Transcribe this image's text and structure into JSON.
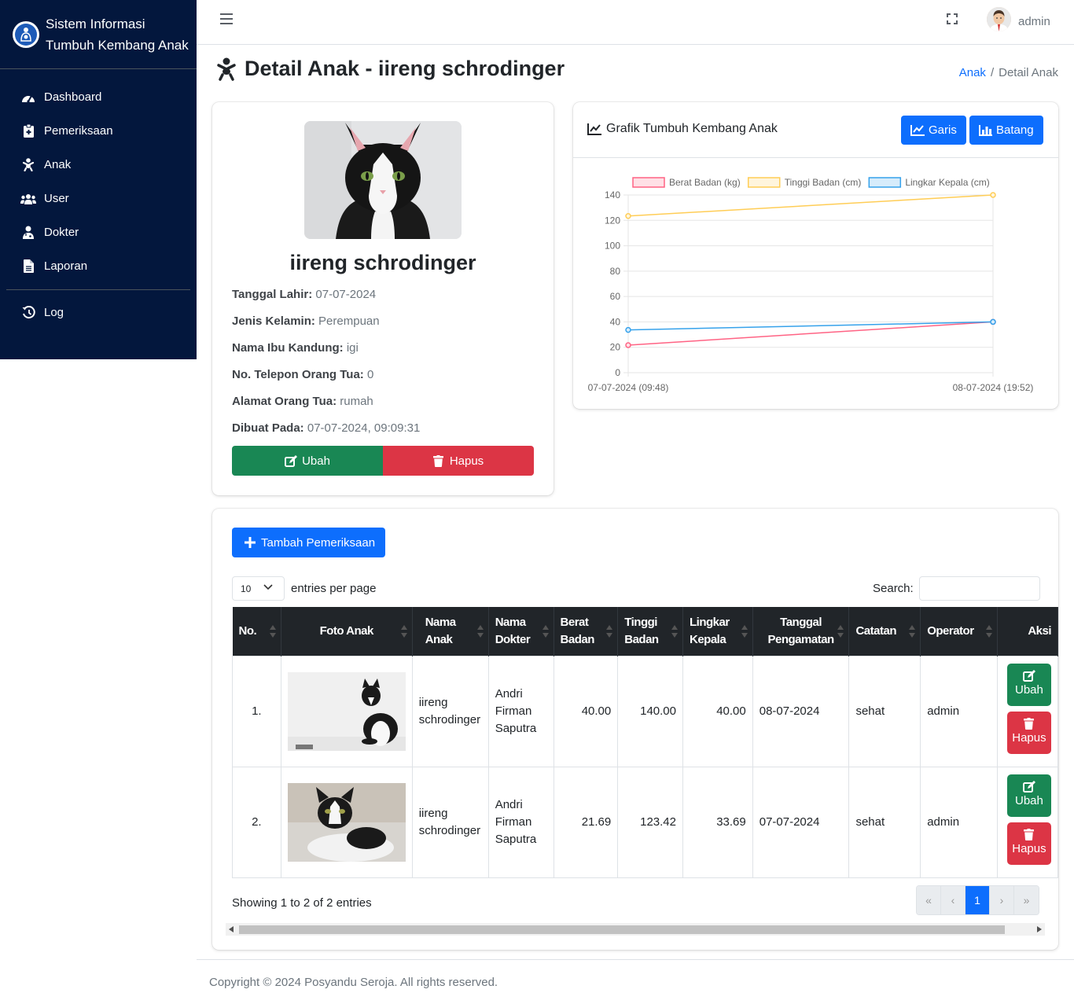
{
  "brand": {
    "line1": "Sistem Informasi",
    "line2": "Tumbuh Kembang Anak"
  },
  "sidebar": {
    "items": [
      {
        "label": "Dashboard",
        "icon": "tachometer-icon"
      },
      {
        "label": "Pemeriksaan",
        "icon": "clipboard-medical-icon"
      },
      {
        "label": "Anak",
        "icon": "baby-icon"
      },
      {
        "label": "User",
        "icon": "users-icon"
      },
      {
        "label": "Dokter",
        "icon": "doctor-icon"
      },
      {
        "label": "Laporan",
        "icon": "file-icon"
      },
      {
        "label": "Log",
        "icon": "history-icon"
      }
    ]
  },
  "topbar": {
    "username": "admin"
  },
  "header": {
    "title": "Detail Anak - iireng schrodinger",
    "breadcrumb": {
      "link": "Anak",
      "current": "Detail Anak"
    }
  },
  "profile": {
    "name": "iireng schrodinger",
    "fields": [
      {
        "label": "Tanggal Lahir:",
        "value": "07-07-2024"
      },
      {
        "label": "Jenis Kelamin:",
        "value": "Perempuan"
      },
      {
        "label": "Nama Ibu Kandung:",
        "value": "igi"
      },
      {
        "label": "No. Telepon Orang Tua:",
        "value": "0"
      },
      {
        "label": "Alamat Orang Tua:",
        "value": "rumah"
      },
      {
        "label": "Dibuat Pada:",
        "value": "07-07-2024, 09:09:31"
      }
    ],
    "edit_label": "Ubah",
    "delete_label": "Hapus"
  },
  "chart_card": {
    "title": "Grafik Tumbuh Kembang Anak",
    "line_button": "Garis",
    "bar_button": "Batang"
  },
  "chart_data": {
    "type": "line",
    "categories": [
      "07-07-2024 (09:48)",
      "08-07-2024 (19:52)"
    ],
    "ylim": [
      0,
      140
    ],
    "yticks": [
      0,
      20,
      40,
      60,
      80,
      100,
      120,
      140
    ],
    "legend_position": "top",
    "series": [
      {
        "name": "Berat Badan (kg)",
        "values": [
          21.69,
          40.0
        ],
        "color": "#ff6384",
        "fill": "#ffe0e6"
      },
      {
        "name": "Tinggi Badan (cm)",
        "values": [
          123.42,
          140.0
        ],
        "color": "#ffcd56",
        "fill": "#fff5dd"
      },
      {
        "name": "Lingkar Kepala (cm)",
        "values": [
          33.69,
          40.0
        ],
        "color": "#36a2eb",
        "fill": "#d7ecfb"
      }
    ]
  },
  "table_section": {
    "add_button": "Tambah Pemeriksaan",
    "page_size": "10",
    "entries_label": "entries per page",
    "search_label": "Search:",
    "columns": [
      {
        "l1": "No.",
        "l2": ""
      },
      {
        "l1": "Foto Anak",
        "l2": ""
      },
      {
        "l1": "Nama",
        "l2": "Anak"
      },
      {
        "l1": "Nama",
        "l2": "Dokter"
      },
      {
        "l1": "Berat",
        "l2": "Badan"
      },
      {
        "l1": "Tinggi",
        "l2": "Badan"
      },
      {
        "l1": "Lingkar",
        "l2": "Kepala"
      },
      {
        "l1": "Tanggal",
        "l2": "Pengamatan"
      },
      {
        "l1": "Catatan",
        "l2": ""
      },
      {
        "l1": "Operator",
        "l2": ""
      },
      {
        "l1": "Aksi",
        "l2": ""
      }
    ],
    "rows": [
      {
        "no": "1.",
        "anak1": "iireng",
        "anak2": "schrodinger",
        "dok1": "Andri",
        "dok2": "Firman",
        "dok3": "Saputra",
        "berat": "40.00",
        "tinggi": "140.00",
        "lingkar": "40.00",
        "tanggal": "08-07-2024",
        "catatan": "sehat",
        "operator": "admin",
        "ubah": "Ubah",
        "hapus": "Hapus"
      },
      {
        "no": "2.",
        "anak1": "iireng",
        "anak2": "schrodinger",
        "dok1": "Andri",
        "dok2": "Firman",
        "dok3": "Saputra",
        "berat": "21.69",
        "tinggi": "123.42",
        "lingkar": "33.69",
        "tanggal": "07-07-2024",
        "catatan": "sehat",
        "operator": "admin",
        "ubah": "Ubah",
        "hapus": "Hapus"
      }
    ],
    "showing": "Showing 1 to 2 of 2 entries",
    "pager": {
      "first": "«",
      "prev": "‹",
      "page": "1",
      "next": "›",
      "last": "»"
    }
  },
  "footer": {
    "text": "Copyright © 2024 Posyandu Seroja. All rights reserved."
  },
  "colors": {
    "sidebar_bg": "#03173d",
    "primary": "#0d6efd",
    "success": "#198754",
    "danger": "#dc3545",
    "table_header": "#212529"
  }
}
